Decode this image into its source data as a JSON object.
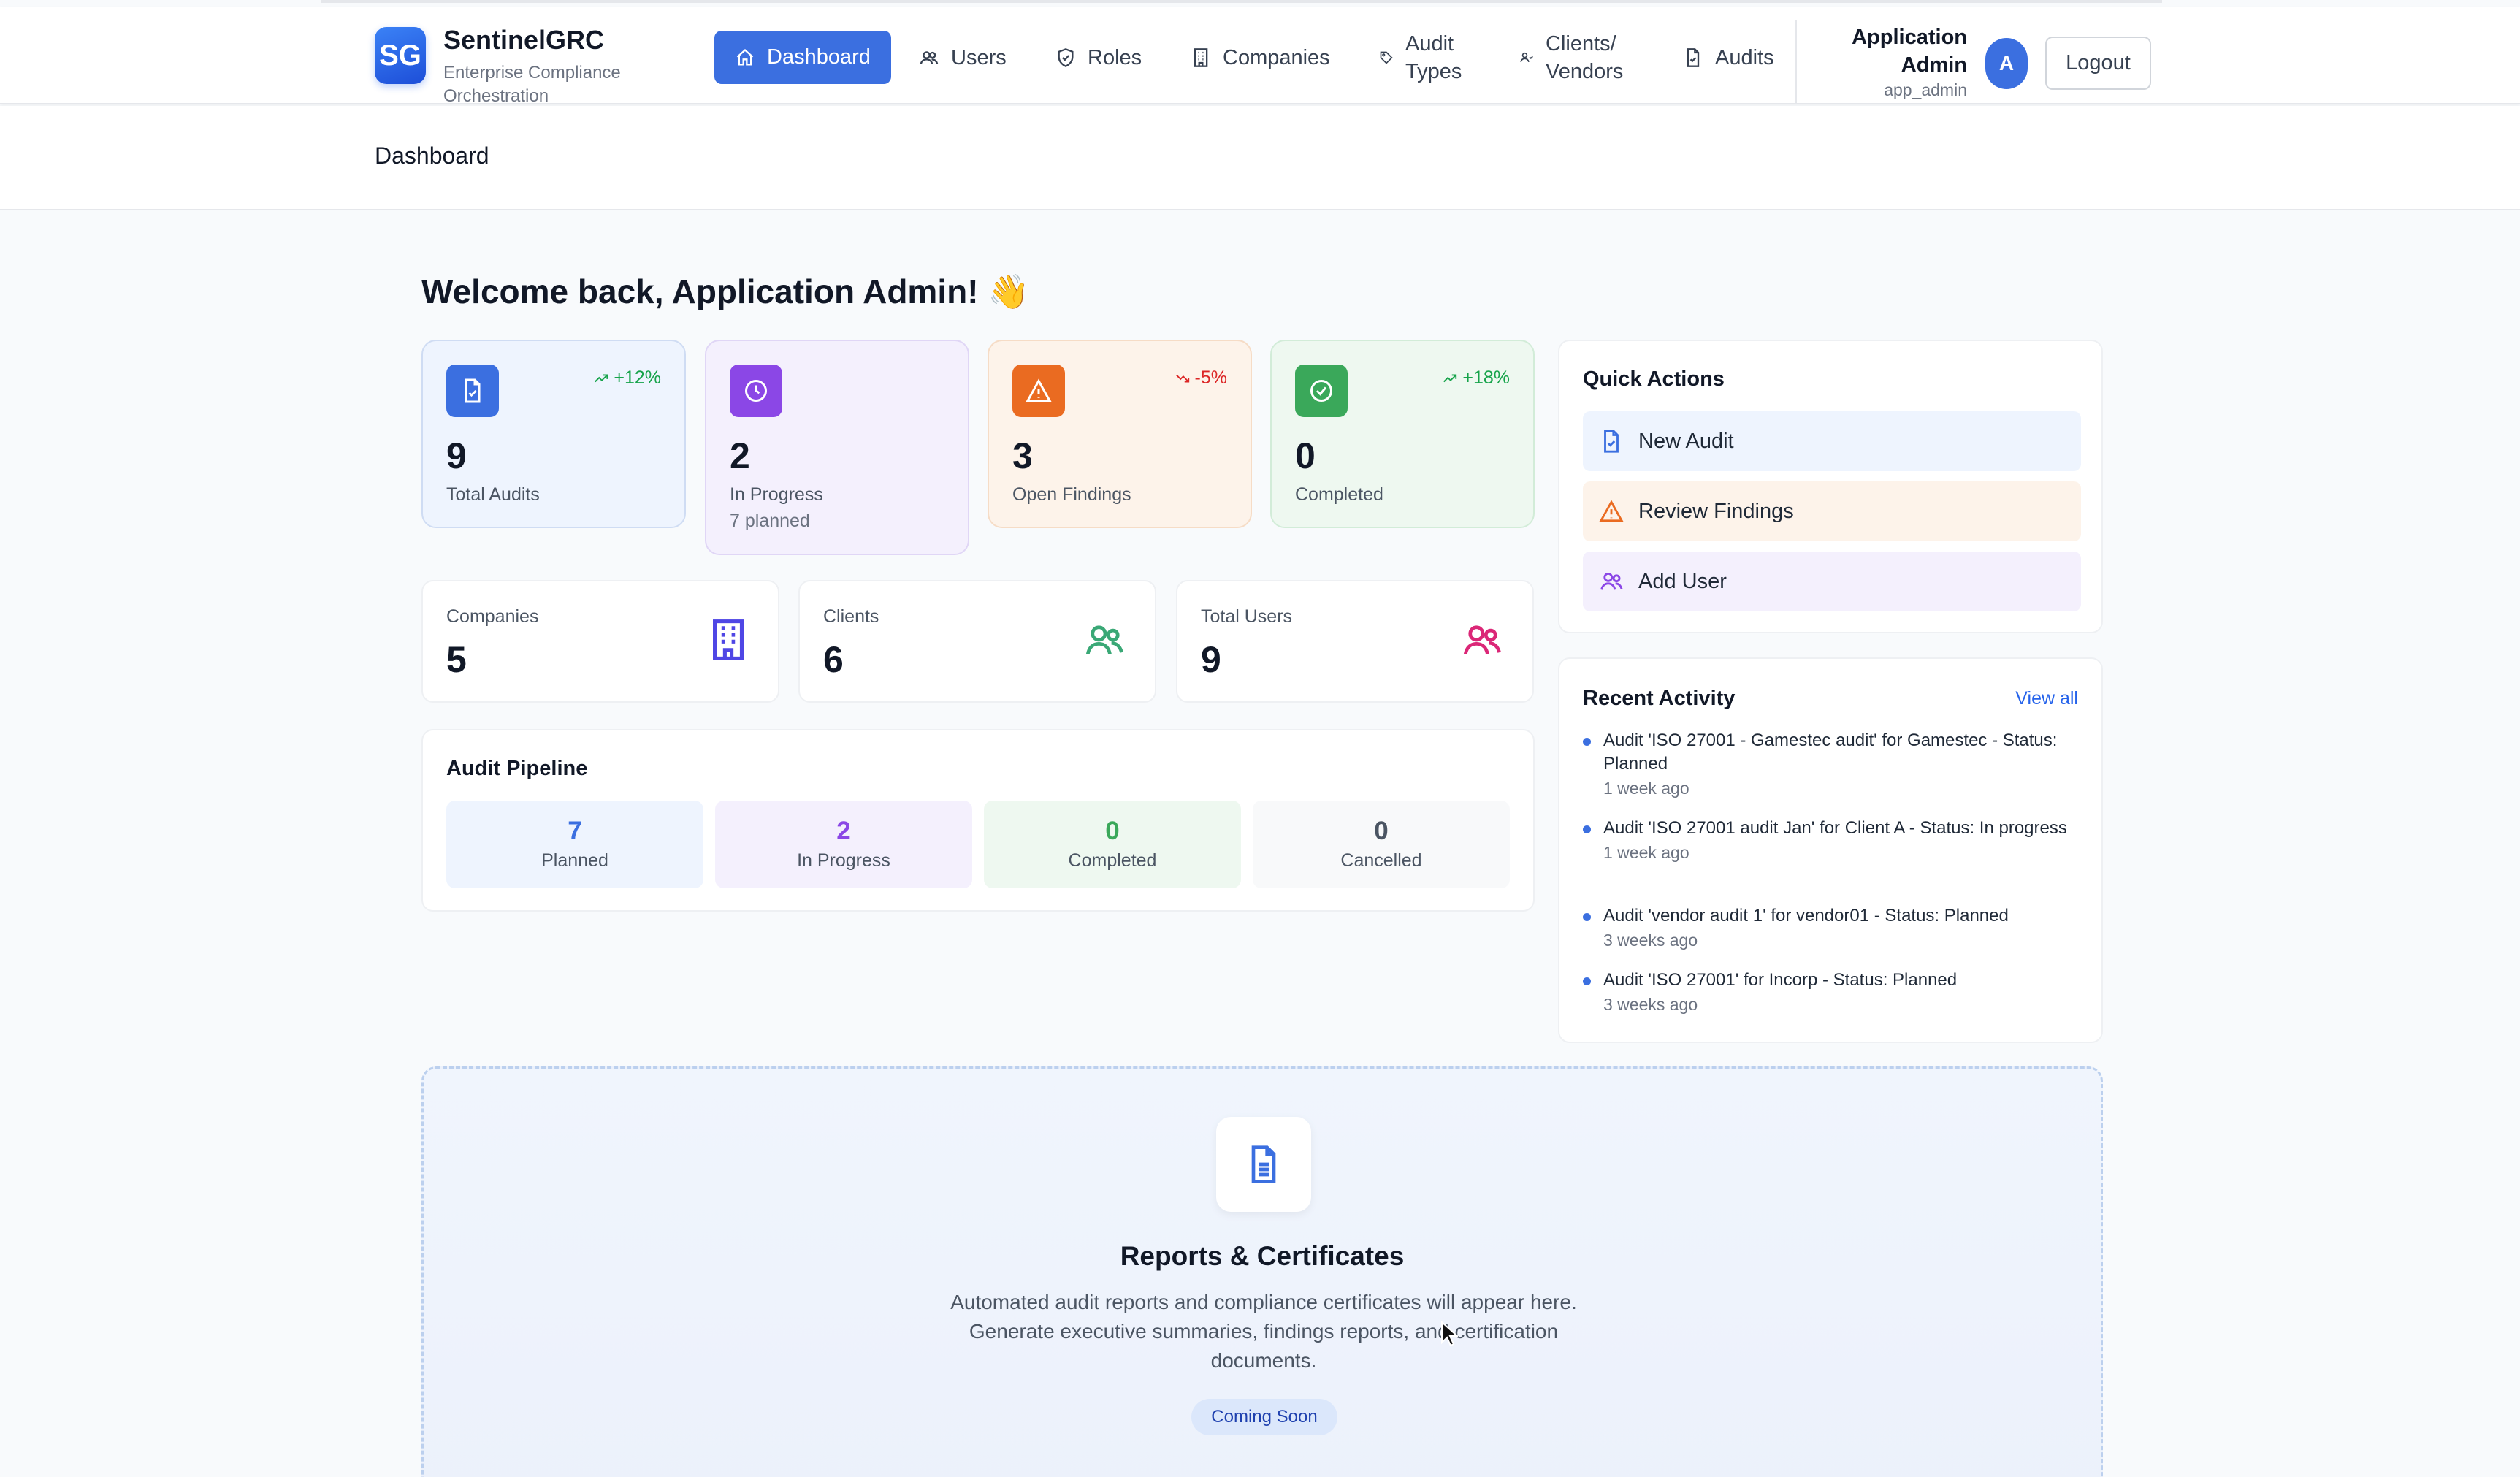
{
  "brand": {
    "logo": "SG",
    "name": "SentinelGRC",
    "subtitle": "Enterprise Compliance Orchestration"
  },
  "nav": [
    {
      "label": "Dashboard",
      "icon": "home-icon",
      "active": true
    },
    {
      "label": "Users",
      "icon": "users-icon"
    },
    {
      "label": "Roles",
      "icon": "shield-icon"
    },
    {
      "label": "Companies",
      "icon": "building-icon"
    },
    {
      "label": "Audit Types",
      "icon": "tag-icon"
    },
    {
      "label": "Clients/ Vendors",
      "icon": "people-icon"
    },
    {
      "label": "Audits",
      "icon": "file-check-icon"
    }
  ],
  "user": {
    "name": "Application Admin",
    "handle": "app_admin",
    "avatar": "A",
    "logout_label": "Logout"
  },
  "breadcrumb": "Dashboard",
  "welcome": "Welcome back, Application Admin! 👋",
  "stats": [
    {
      "value": "9",
      "label": "Total Audits",
      "trend": "+12%",
      "trend_dir": "up",
      "color": "#3b6fe0",
      "icon": "file-check-icon"
    },
    {
      "value": "2",
      "label": "In Progress",
      "sub": "7 planned",
      "color": "#8b47e6",
      "icon": "clock-icon"
    },
    {
      "value": "3",
      "label": "Open Findings",
      "trend": "-5%",
      "trend_dir": "down",
      "color": "#ea6b21",
      "icon": "alert-triangle-icon"
    },
    {
      "value": "0",
      "label": "Completed",
      "trend": "+18%",
      "trend_dir": "up",
      "color": "#3aa85a",
      "icon": "check-circle-icon"
    }
  ],
  "entities": [
    {
      "label": "Companies",
      "value": "5",
      "icon": "building-icon"
    },
    {
      "label": "Clients",
      "value": "6",
      "icon": "clients-icon"
    },
    {
      "label": "Total Users",
      "value": "9",
      "icon": "users-icon"
    }
  ],
  "pipeline": {
    "title": "Audit Pipeline",
    "items": [
      {
        "value": "7",
        "label": "Planned"
      },
      {
        "value": "2",
        "label": "In Progress"
      },
      {
        "value": "0",
        "label": "Completed"
      },
      {
        "value": "0",
        "label": "Cancelled"
      }
    ]
  },
  "quick_actions": {
    "title": "Quick Actions",
    "items": [
      {
        "label": "New Audit",
        "icon": "file-check-icon"
      },
      {
        "label": "Review Findings",
        "icon": "alert-triangle-icon"
      },
      {
        "label": "Add User",
        "icon": "users-icon"
      }
    ]
  },
  "recent_activity": {
    "title": "Recent Activity",
    "view_all": "View all",
    "items": [
      {
        "text": "Audit 'ISO 27001 - Gamestec audit' for Gamestec - Status: Planned",
        "time": "1 week ago"
      },
      {
        "text": "Audit 'ISO 27001 audit Jan' for Client A - Status: In progress",
        "time": "1 week ago"
      },
      {
        "text": "Audit 'vendor audit 1' for vendor01 - Status: Planned",
        "time": "3 weeks ago"
      },
      {
        "text": "Audit 'ISO 27001' for Incorp - Status: Planned",
        "time": "3 weeks ago"
      }
    ]
  },
  "reports": {
    "title": "Reports & Certificates",
    "description": "Automated audit reports and compliance certificates will appear here. Generate executive summaries, findings reports, and certification documents.",
    "badge": "Coming Soon",
    "icon": "document-icon"
  }
}
